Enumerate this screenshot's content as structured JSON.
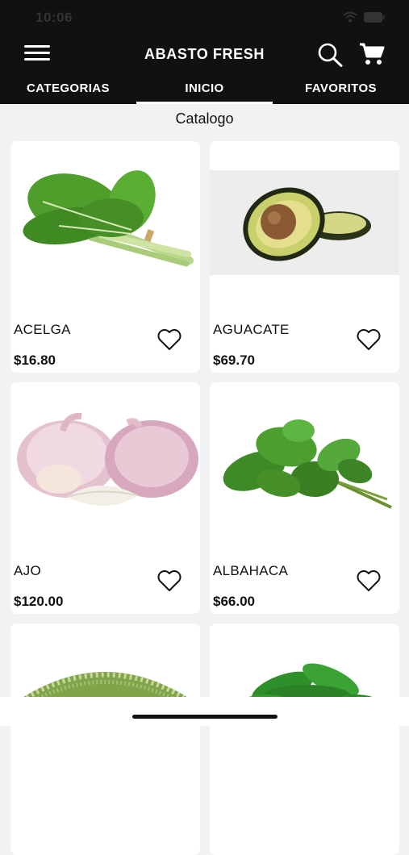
{
  "status": {
    "time": "10:06"
  },
  "header": {
    "title": "ABASTO FRESH",
    "menu_icon": "hamburger-menu-icon",
    "search_icon": "search-icon",
    "cart_icon": "cart-icon"
  },
  "tabs": [
    {
      "label": "CATEGORIAS",
      "active": false
    },
    {
      "label": "INICIO",
      "active": true
    },
    {
      "label": "FAVORITOS",
      "active": false
    }
  ],
  "section": {
    "title": "Catalogo"
  },
  "products": [
    {
      "name": "ACELGA",
      "price": "$16.80",
      "image": "chard-image",
      "favorite": false
    },
    {
      "name": "AGUACATE",
      "price": "$69.70",
      "image": "avocado-image",
      "favorite": false
    },
    {
      "name": "AJO",
      "price": "$120.00",
      "image": "garlic-image",
      "favorite": false
    },
    {
      "name": "ALBAHACA",
      "price": "$66.00",
      "image": "basil-image",
      "favorite": false
    },
    {
      "name": "",
      "price": "",
      "image": "sprouts-image",
      "favorite": false
    },
    {
      "name": "",
      "price": "",
      "image": "arugula-image",
      "favorite": false
    }
  ],
  "colors": {
    "header_bg": "#111111",
    "page_bg": "#f2f2f4",
    "card_bg": "#ffffff"
  }
}
